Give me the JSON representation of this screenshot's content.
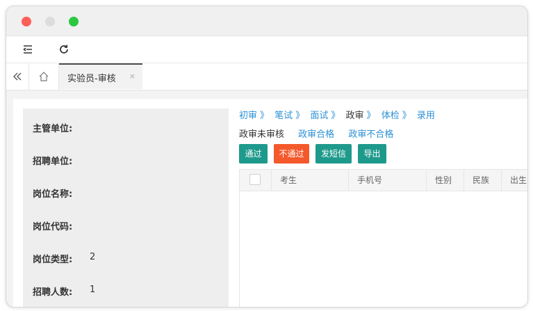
{
  "window": {
    "traffic_lights": [
      "#fe5f57",
      "#dcdcdc",
      "#2bc840"
    ]
  },
  "toolbar": {
    "icons": [
      "menu-collapse-icon",
      "refresh-icon"
    ]
  },
  "tabs": {
    "nav_icons": [
      "double-chevron-left-icon",
      "home-icon"
    ],
    "active_label": "实验员-审核",
    "close_label": "×"
  },
  "info": {
    "fields": [
      {
        "label": "主管单位:",
        "value": ""
      },
      {
        "label": "招聘单位:",
        "value": ""
      },
      {
        "label": "岗位名称:",
        "value": ""
      },
      {
        "label": "岗位代码:",
        "value": ""
      },
      {
        "label": "岗位类型:",
        "value": "2"
      },
      {
        "label": "招聘人数:",
        "value": "1"
      }
    ]
  },
  "steps": {
    "items": [
      {
        "label": "初审",
        "current": false
      },
      {
        "label": "笔试",
        "current": false
      },
      {
        "label": "面试",
        "current": false
      },
      {
        "label": "政审",
        "current": true
      },
      {
        "label": "体检",
        "current": false
      },
      {
        "label": "录用",
        "current": false
      }
    ],
    "separator": "》"
  },
  "subtabs": {
    "items": [
      {
        "label": "政审未审核",
        "current": true
      },
      {
        "label": "政审合格",
        "current": false
      },
      {
        "label": "政审不合格",
        "current": false
      }
    ]
  },
  "actions": {
    "pass": "通过",
    "reject": "不通过",
    "sms": "发短信",
    "export": "导出"
  },
  "table": {
    "columns": [
      "考生",
      "手机号",
      "性别",
      "民族",
      "出生"
    ],
    "rows": []
  },
  "colors": {
    "link": "#2a90d5",
    "primary": "#1e9a8c",
    "danger": "#f4592c"
  }
}
